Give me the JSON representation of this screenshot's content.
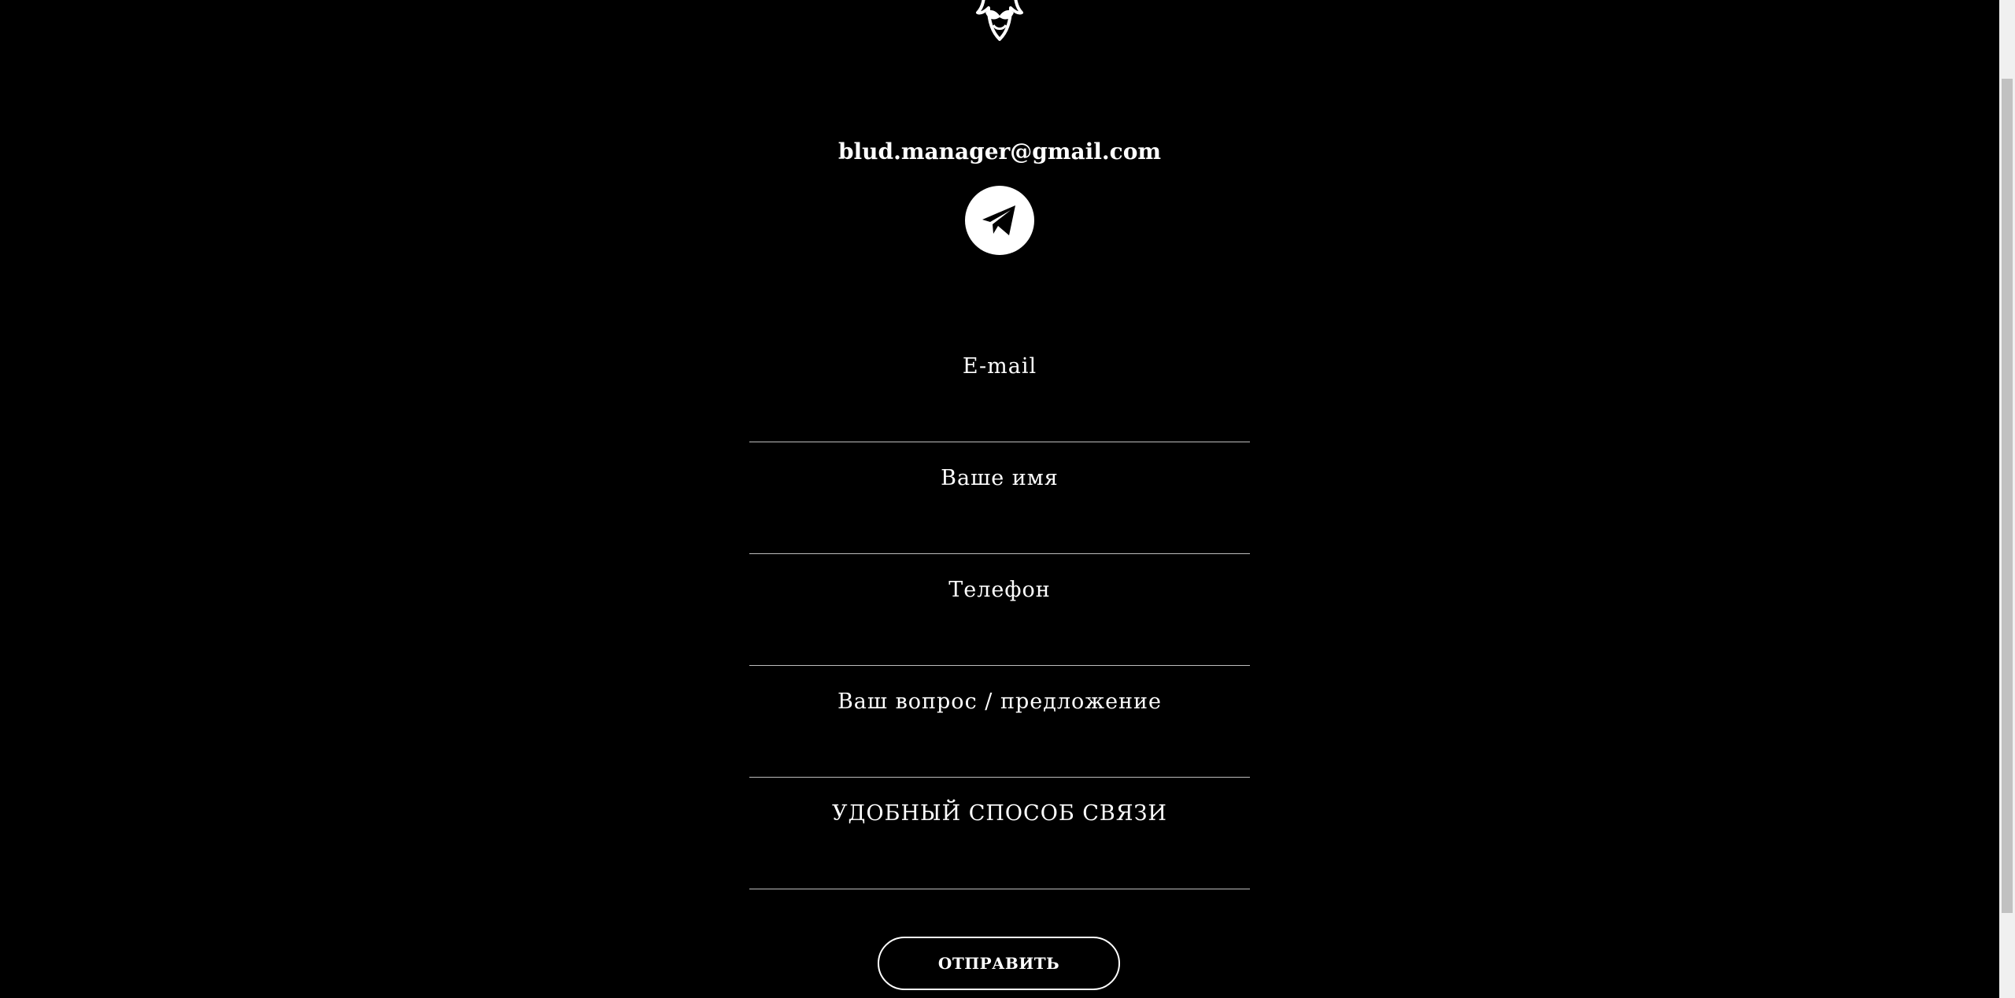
{
  "contact": {
    "email": "blud.manager@gmail.com",
    "telegram_icon": "telegram-icon",
    "logo_icon": "mustache-face-logo"
  },
  "form": {
    "fields": [
      {
        "placeholder": "E-mail",
        "type": "email"
      },
      {
        "placeholder": "Ваше имя",
        "type": "text"
      },
      {
        "placeholder": "Телефон",
        "type": "tel"
      },
      {
        "placeholder": "Ваш вопрос / предложение",
        "type": "text"
      }
    ],
    "contact_method_label": "УДОБНЫЙ СПОСОБ СВЯЗИ",
    "submit_label": "ОТПРАВИТЬ"
  },
  "colors": {
    "background": "#000000",
    "text": "#ffffff",
    "divider": "#bdbdbd"
  }
}
